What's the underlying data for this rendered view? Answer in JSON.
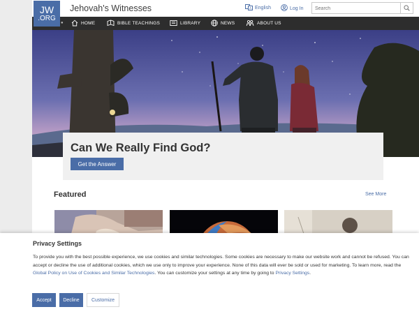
{
  "header": {
    "logo_line1": "JW",
    "logo_line2": ".ORG",
    "site_title": "Jehovah's Witnesses",
    "language": "English",
    "login": "Log In",
    "search_placeholder": "Search"
  },
  "nav": {
    "items": [
      {
        "label": "HOME",
        "icon": "home-icon"
      },
      {
        "label": "BIBLE TEACHINGS",
        "icon": "book-icon"
      },
      {
        "label": "LIBRARY",
        "icon": "library-icon"
      },
      {
        "label": "NEWS",
        "icon": "globe-icon"
      },
      {
        "label": "ABOUT US",
        "icon": "people-icon"
      }
    ]
  },
  "hero": {
    "title": "Can We Really Find God?",
    "button": "Get the Answer"
  },
  "featured": {
    "title": "Featured",
    "see_more": "See More"
  },
  "privacy": {
    "title": "Privacy Settings",
    "text_before_link1": "To provide you with the best possible experience, we use cookies and similar technologies. Some cookies are necessary to make our website work and cannot be refused. You can accept or decline the use of additional cookies, which we use only to improve your experience. None of this data will ever be sold or used for marketing. To learn more, read the ",
    "link1": "Global Policy on Use of Cookies and Similar Technologies",
    "text_between": ". You can customize your settings at any time by going to ",
    "link2": "Privacy Settings",
    "text_after": ".",
    "accept": "Accept",
    "decline": "Decline",
    "customize": "Customize"
  },
  "colors": {
    "brand_blue": "#4a6da7",
    "nav_bg": "#2d2d2d"
  }
}
